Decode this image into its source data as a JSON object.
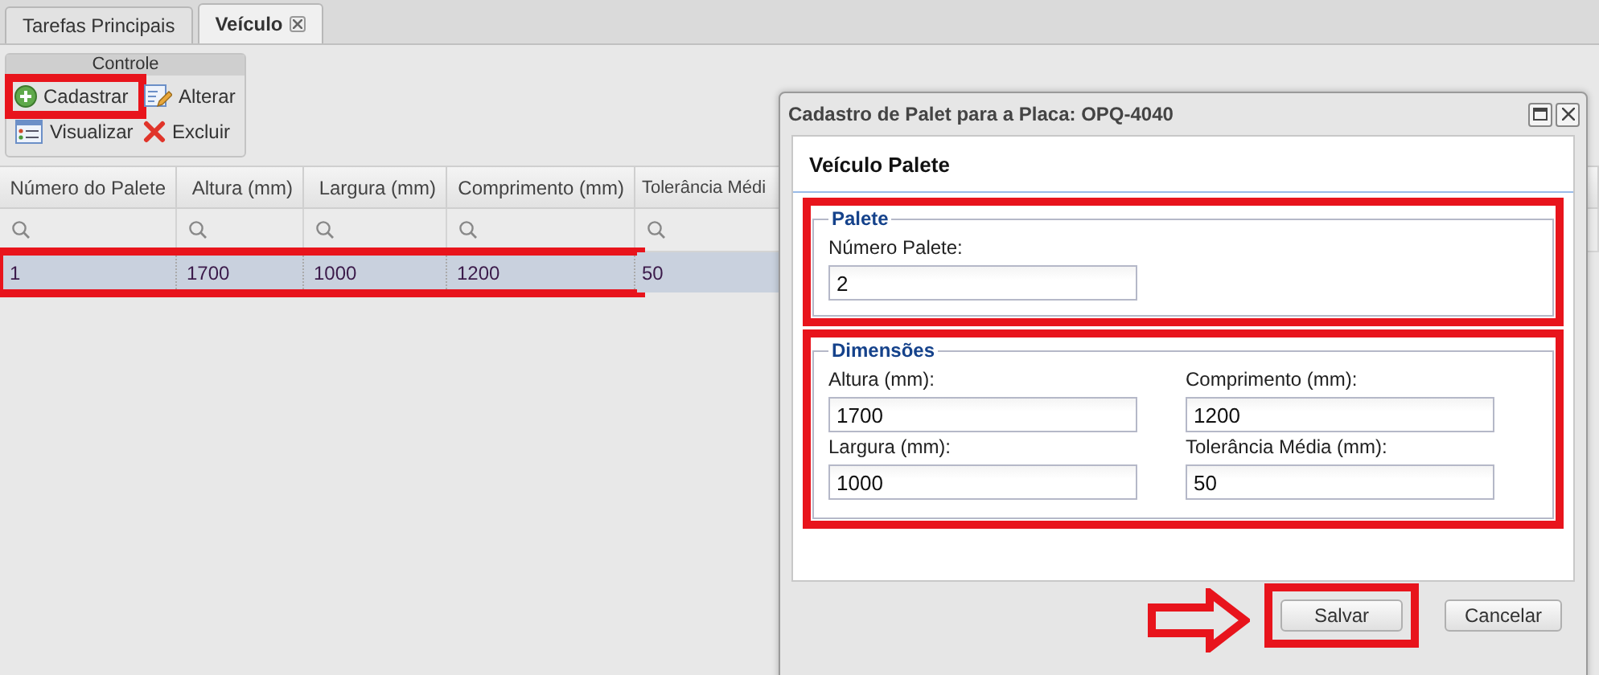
{
  "tabs": [
    {
      "label": "Tarefas Principais",
      "selected": false,
      "closable": false
    },
    {
      "label": "Veículo",
      "selected": true,
      "closable": true
    }
  ],
  "toolbar": {
    "title": "Controle",
    "buttons": [
      {
        "label": "Cadastrar",
        "kind": "add",
        "highlighted": true
      },
      {
        "label": "Alterar",
        "kind": "edit",
        "highlighted": false
      },
      {
        "label": "Visualizar",
        "kind": "view",
        "highlighted": false
      },
      {
        "label": "Excluir",
        "kind": "delete",
        "highlighted": false
      }
    ]
  },
  "table": {
    "columns": [
      "Número do Palete",
      "Altura (mm)",
      "Largura (mm)",
      "Comprimento (mm)",
      "Tolerância Médi"
    ],
    "rows": [
      {
        "cells": [
          "1",
          "1700",
          "1000",
          "1200",
          "50"
        ],
        "selected": true,
        "highlighted": true
      }
    ]
  },
  "dialog": {
    "title": "Cadastro de Palet para a Placa: OPQ-4040",
    "header": "Veículo Palete",
    "sections": [
      {
        "legend": "Palete",
        "highlighted": true,
        "fields": [
          {
            "label": "Número Palete:",
            "value": "2"
          }
        ]
      },
      {
        "legend": "Dimensões",
        "highlighted": true,
        "fields": [
          {
            "label": "Altura (mm):",
            "value": "1700"
          },
          {
            "label": "Comprimento (mm):",
            "value": "1200"
          },
          {
            "label": "Largura (mm):",
            "value": "1000"
          },
          {
            "label": "Tolerância Média (mm):",
            "value": "50"
          }
        ]
      }
    ],
    "buttons": [
      {
        "label": "Salvar",
        "highlighted": true,
        "pointed": true
      },
      {
        "label": "Cancelar",
        "highlighted": false,
        "pointed": false
      }
    ]
  }
}
